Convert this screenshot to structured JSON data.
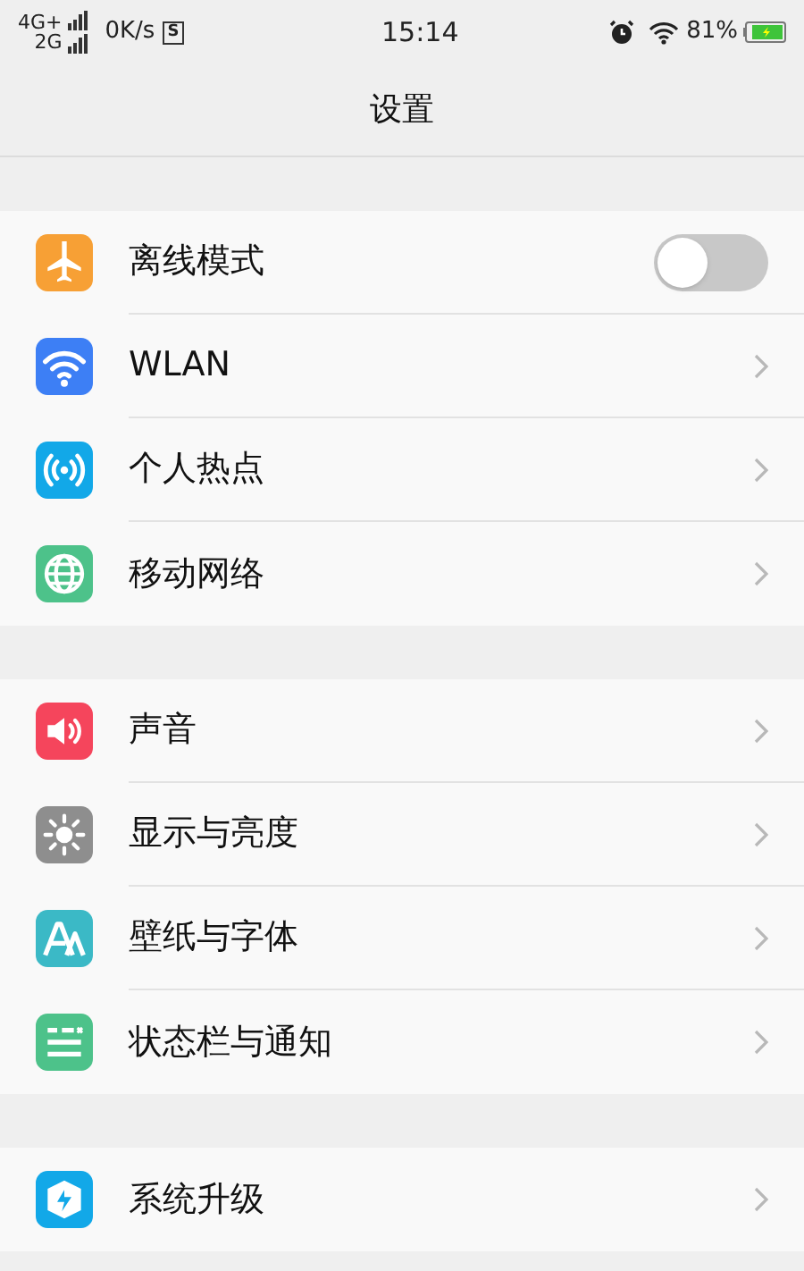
{
  "status_bar": {
    "network_top": "4G+",
    "network_bottom": "2G",
    "speed": "0K/s",
    "sim_badge": "S",
    "time": "15:14",
    "battery": "81%"
  },
  "title": "设置",
  "groups": [
    {
      "items": [
        {
          "kind": "toggle",
          "label": "离线模式",
          "on": false
        },
        {
          "kind": "link",
          "label": "WLAN"
        },
        {
          "kind": "link",
          "label": "个人热点"
        },
        {
          "kind": "link",
          "label": "移动网络"
        }
      ]
    },
    {
      "items": [
        {
          "kind": "link",
          "label": "声音"
        },
        {
          "kind": "link",
          "label": "显示与亮度"
        },
        {
          "kind": "link",
          "label": "壁纸与字体"
        },
        {
          "kind": "link",
          "label": "状态栏与通知"
        }
      ]
    },
    {
      "items": [
        {
          "kind": "link",
          "label": "系统升级"
        }
      ]
    }
  ]
}
